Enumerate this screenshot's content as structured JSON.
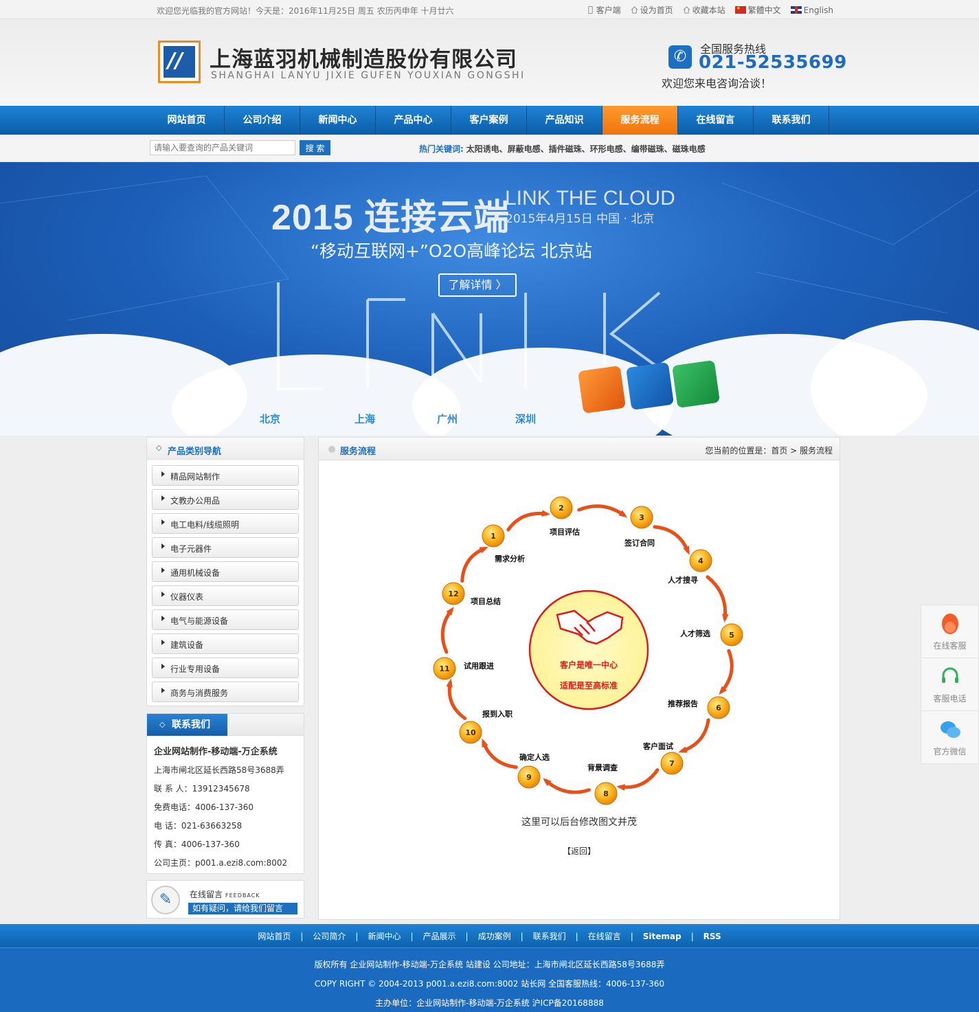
{
  "topbar": {
    "welcome": "欢迎您光临我的官方网站！今天是：2016年11月25日 周五 农历丙申年 十月廿六",
    "links": [
      "客户端",
      "设为首页",
      "收藏本站",
      "繁體中文",
      "English"
    ]
  },
  "header": {
    "company_cn": "上海蓝羽机械制造股份有限公司",
    "company_en": "SHANGHAI LANYU JIXIE GUFEN YOUXIAN GONGSHI",
    "hotline_label": "全国服务热线",
    "hotline_number": "021-52535699",
    "hotline_sub": "欢迎您来电咨询洽谈！"
  },
  "nav": {
    "items": [
      "网站首页",
      "公司介绍",
      "新闻中心",
      "产品中心",
      "客户案例",
      "产品知识",
      "服务流程",
      "在线留言",
      "联系我们"
    ],
    "active": "服务流程"
  },
  "search": {
    "placeholder": "请输入要查询的产品关键词",
    "button": "搜 索",
    "hot_label": "热门关键词:",
    "keywords": "太阳诱电、屏蔽电感、插件磁珠、环形电感、编带磁珠、磁珠电感"
  },
  "banner": {
    "title": "2015 连接云端",
    "title_en": "LINK THE CLOUD",
    "date": "2015年4月15日 中国 · 北京",
    "subtitle": "“移动互联网+”O2O高峰论坛 北京站",
    "button": "了解详情 〉",
    "cities": [
      "北京",
      "上海",
      "广州",
      "深圳"
    ]
  },
  "sidebar": {
    "category_title": "产品类别导航",
    "categories": [
      "精品网站制作",
      "文教办公用品",
      "电工电料/线缆照明",
      "电子元器件",
      "通用机械设备",
      "仪器仪表",
      "电气与能源设备",
      "建筑设备",
      "行业专用设备",
      "商务与消费服务"
    ],
    "contact_title": "联系我们",
    "contact": {
      "company": "企业网站制作-移动端-万企系统",
      "address": "上海市闸北区延长西路58号3688弄",
      "contact_person": "联 系 人：13912345678",
      "free_tel": "免费电话：4006-137-360",
      "tel": "电 话：021-63663258",
      "fax": "传 真：4006-137-360",
      "homepage": "公司主页：p001.a.ezi8.com:8002"
    },
    "feedback_title": "在线留言",
    "feedback_en": "FEEDBACK",
    "feedback_sub": "如有疑问，请给我们留言"
  },
  "main": {
    "title": "服务流程",
    "breadcrumb": "您当前的位置是：首页 > 服务流程",
    "center_line1": "客户是唯一中心",
    "center_line2": "适配是至高标准",
    "steps": [
      {
        "n": "1",
        "label": "需求分析"
      },
      {
        "n": "2",
        "label": "项目评估"
      },
      {
        "n": "3",
        "label": "签订合同"
      },
      {
        "n": "4",
        "label": "人才搜寻"
      },
      {
        "n": "5",
        "label": "人才筛选"
      },
      {
        "n": "6",
        "label": "推荐报告"
      },
      {
        "n": "7",
        "label": "客户面试"
      },
      {
        "n": "8",
        "label": "背景调查"
      },
      {
        "n": "9",
        "label": "确定人选"
      },
      {
        "n": "10",
        "label": "报到入职"
      },
      {
        "n": "11",
        "label": "试用跟进"
      },
      {
        "n": "12",
        "label": "项目总结"
      }
    ],
    "caption": "这里可以后台修改图文并茂",
    "back": "【返回】"
  },
  "float": {
    "items": [
      "在线客服",
      "客服电话",
      "官方微信"
    ]
  },
  "footer": {
    "nav": [
      "网站首页",
      "公司简介",
      "新闻中心",
      "产品展示",
      "成功案例",
      "联系我们",
      "在线留言",
      "Sitemap",
      "RSS"
    ],
    "line1": "版权所有 企业网站制作-移动端-万企系统 站建设 公司地址：上海市闸北区延长西路58号3688弄",
    "line2": "COPY RIGHT © 2004-2013 p001.a.ezi8.com:8002 站长网 全国客服热线：4006-137-360",
    "line3": "主办单位：企业网站制作-移动端-万企系统 沪ICP备20168888"
  }
}
